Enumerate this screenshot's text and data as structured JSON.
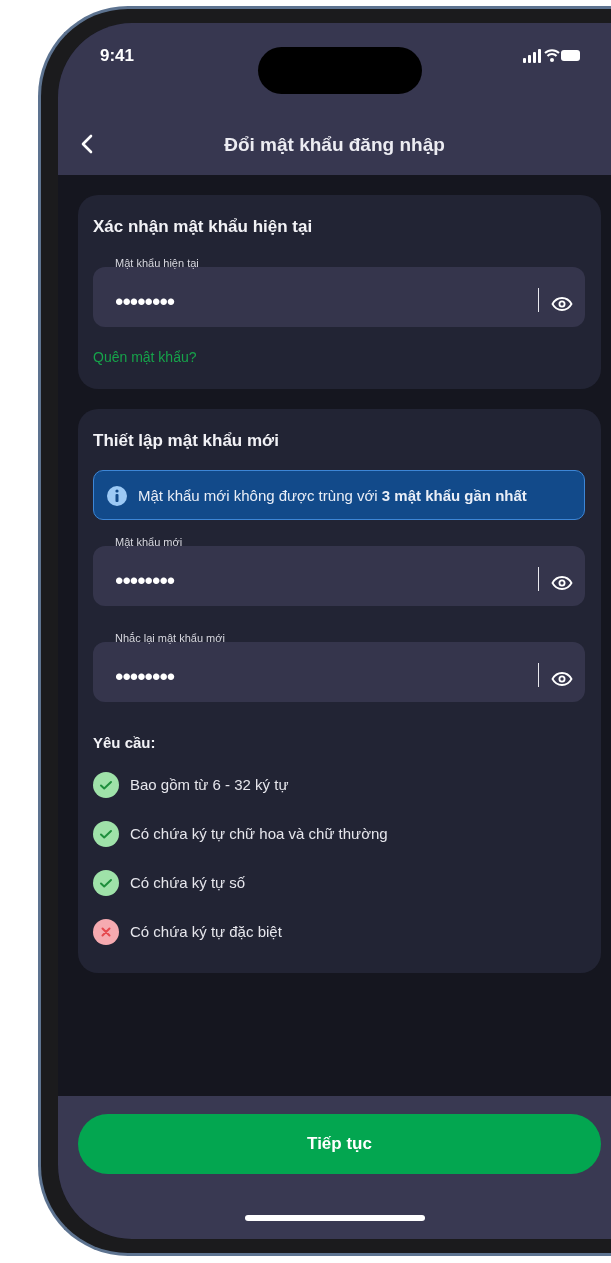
{
  "status_bar": {
    "time": "9:41"
  },
  "nav": {
    "title": "Đổi mật khẩu đăng nhập"
  },
  "current_section": {
    "title": "Xác nhận mật khẩu hiện tại",
    "field": {
      "label": "Mật khẩu hiện tại",
      "value": "••••••••"
    },
    "forgot_link": "Quên mật khẩu?"
  },
  "new_section": {
    "title": "Thiết lập mật khẩu mới",
    "notice": "Mật khẩu mới không được trùng với **3 mật khẩu gần nhất**",
    "fields": [
      {
        "label": "Mật khẩu mới",
        "value": "••••••••"
      },
      {
        "label": "Nhắc lại mật khẩu mới",
        "value": "••••••••"
      }
    ],
    "requirements_title": "Yêu cầu:",
    "requirements": [
      {
        "text": "Bao gồm từ 6 - 32 ký tự",
        "met": true
      },
      {
        "text": "Có chứa ký tự chữ hoa và chữ thường",
        "met": true
      },
      {
        "text": "Có chứa ký tự số",
        "met": true
      },
      {
        "text": "Có chứa ký tự đặc biệt",
        "met": false
      }
    ]
  },
  "continue_button": "Tiếp tục"
}
